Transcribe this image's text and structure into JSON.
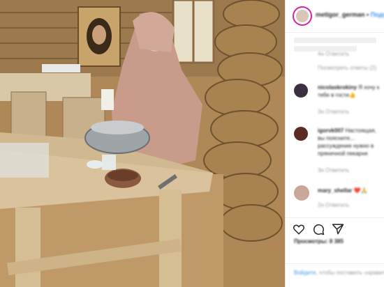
{
  "post": {
    "username": "metigor_german",
    "follow_label": "Подписаться",
    "separator": " • "
  },
  "comments": [
    {
      "user": "",
      "text": "",
      "meta": "4н  Ответить"
    },
    {
      "user": "",
      "text": "",
      "meta": "Посмотреть ответы (2)"
    },
    {
      "user": "nicolaskrokiny",
      "text": "Я хочу к тебе в гости👍",
      "meta": "3н  Ответить"
    },
    {
      "user": "igorvk007",
      "text": "Настоящая, вы поясните... рассуждение нужно в пряничной пекарне",
      "meta": "3н  Ответить"
    },
    {
      "user": "mary_shellar",
      "text": "❤️🙏",
      "meta": "2н  Ответить"
    }
  ],
  "actions": {
    "views": "Просмотры: 8 385",
    "add_comment_prefix": "Войдите",
    "add_comment_suffix": ", чтобы поставить «нравится» или оставить комментарий."
  },
  "icons": [
    "heart-icon",
    "comment-icon",
    "share-icon"
  ]
}
